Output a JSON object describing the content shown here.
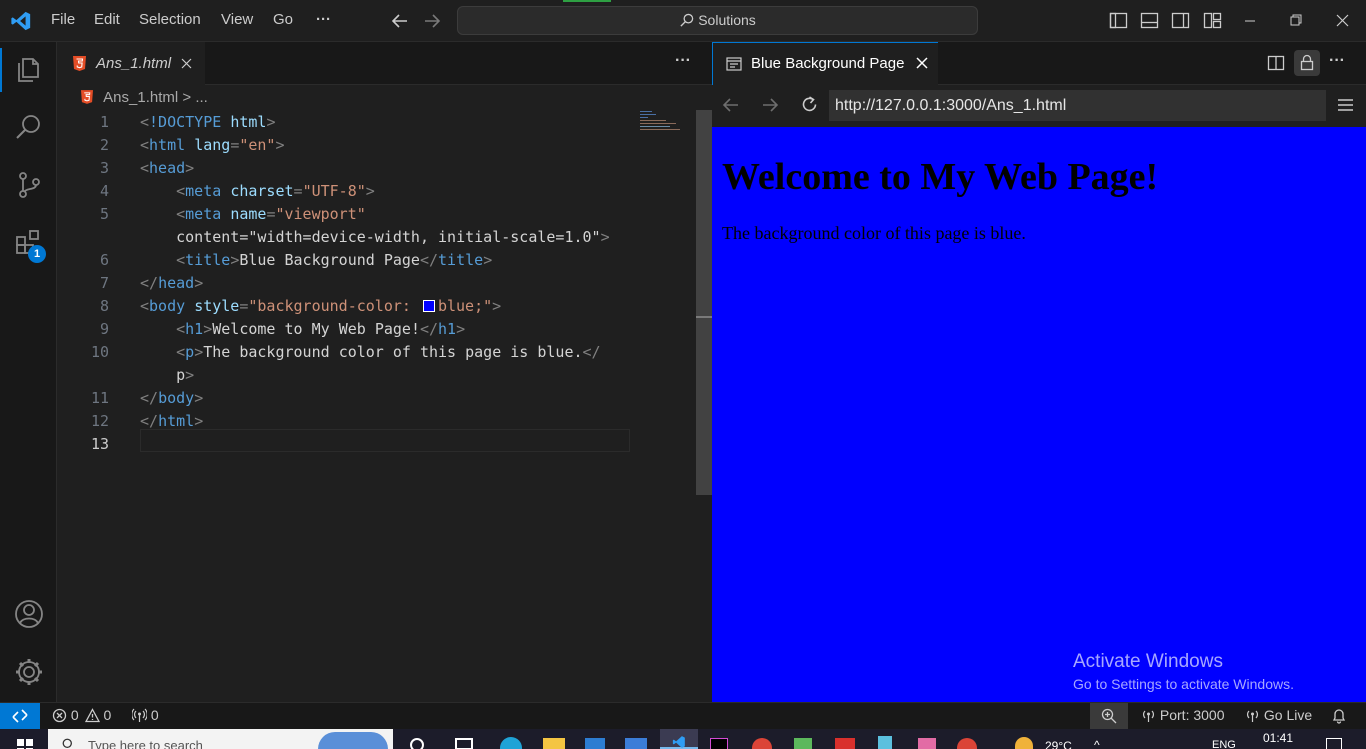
{
  "titlebar": {
    "menu": [
      "File",
      "Edit",
      "Selection",
      "View",
      "Go"
    ],
    "more": "···",
    "search_label": "Solutions"
  },
  "activity": {
    "extensions_badge": "1"
  },
  "editor": {
    "tab_title": "Ans_1.html",
    "breadcrumb_file": "Ans_1.html",
    "breadcrumb_sep": ">",
    "breadcrumb_more": "...",
    "more": "···",
    "line_numbers": [
      "1",
      "2",
      "3",
      "4",
      "5",
      "",
      "6",
      "7",
      "8",
      "9",
      "10",
      "",
      "11",
      "12",
      "13"
    ],
    "lines": [
      "<!DOCTYPE html>",
      "<html lang=\"en\">",
      "<head>",
      "    <meta charset=\"UTF-8\">",
      "    <meta name=\"viewport\"",
      "    content=\"width=device-width, initial-scale=1.0\">",
      "    <title>Blue Background Page</title>",
      "</head>",
      "<body style=\"background-color: ■blue;\">",
      "    <h1>Welcome to My Web Page!</h1>",
      "    <p>The background color of this page is blue.</",
      "    p>",
      "</body>",
      "</html>",
      ""
    ]
  },
  "browser": {
    "tab_title": "Blue Background Page",
    "url": "http://127.0.0.1:3000/Ans_1.html",
    "page_heading": "Welcome to My Web Page!",
    "page_paragraph": "The background color of this page is blue.",
    "background_color": "#0000ff",
    "more": "···"
  },
  "watermark": {
    "title": "Activate Windows",
    "subtitle": "Go to Settings to activate Windows."
  },
  "status": {
    "errors": "0",
    "warnings": "0",
    "ports": "0",
    "port_label": "Port: 3000",
    "golive_label": "Go Live"
  },
  "taskbar": {
    "search_placeholder": "Type here to search",
    "temperature": "29°C",
    "language": "ENG",
    "time": "01:41"
  },
  "colors": {
    "accent": "#0078d4",
    "remote": "#0078d4",
    "badge": "#0078d4"
  }
}
